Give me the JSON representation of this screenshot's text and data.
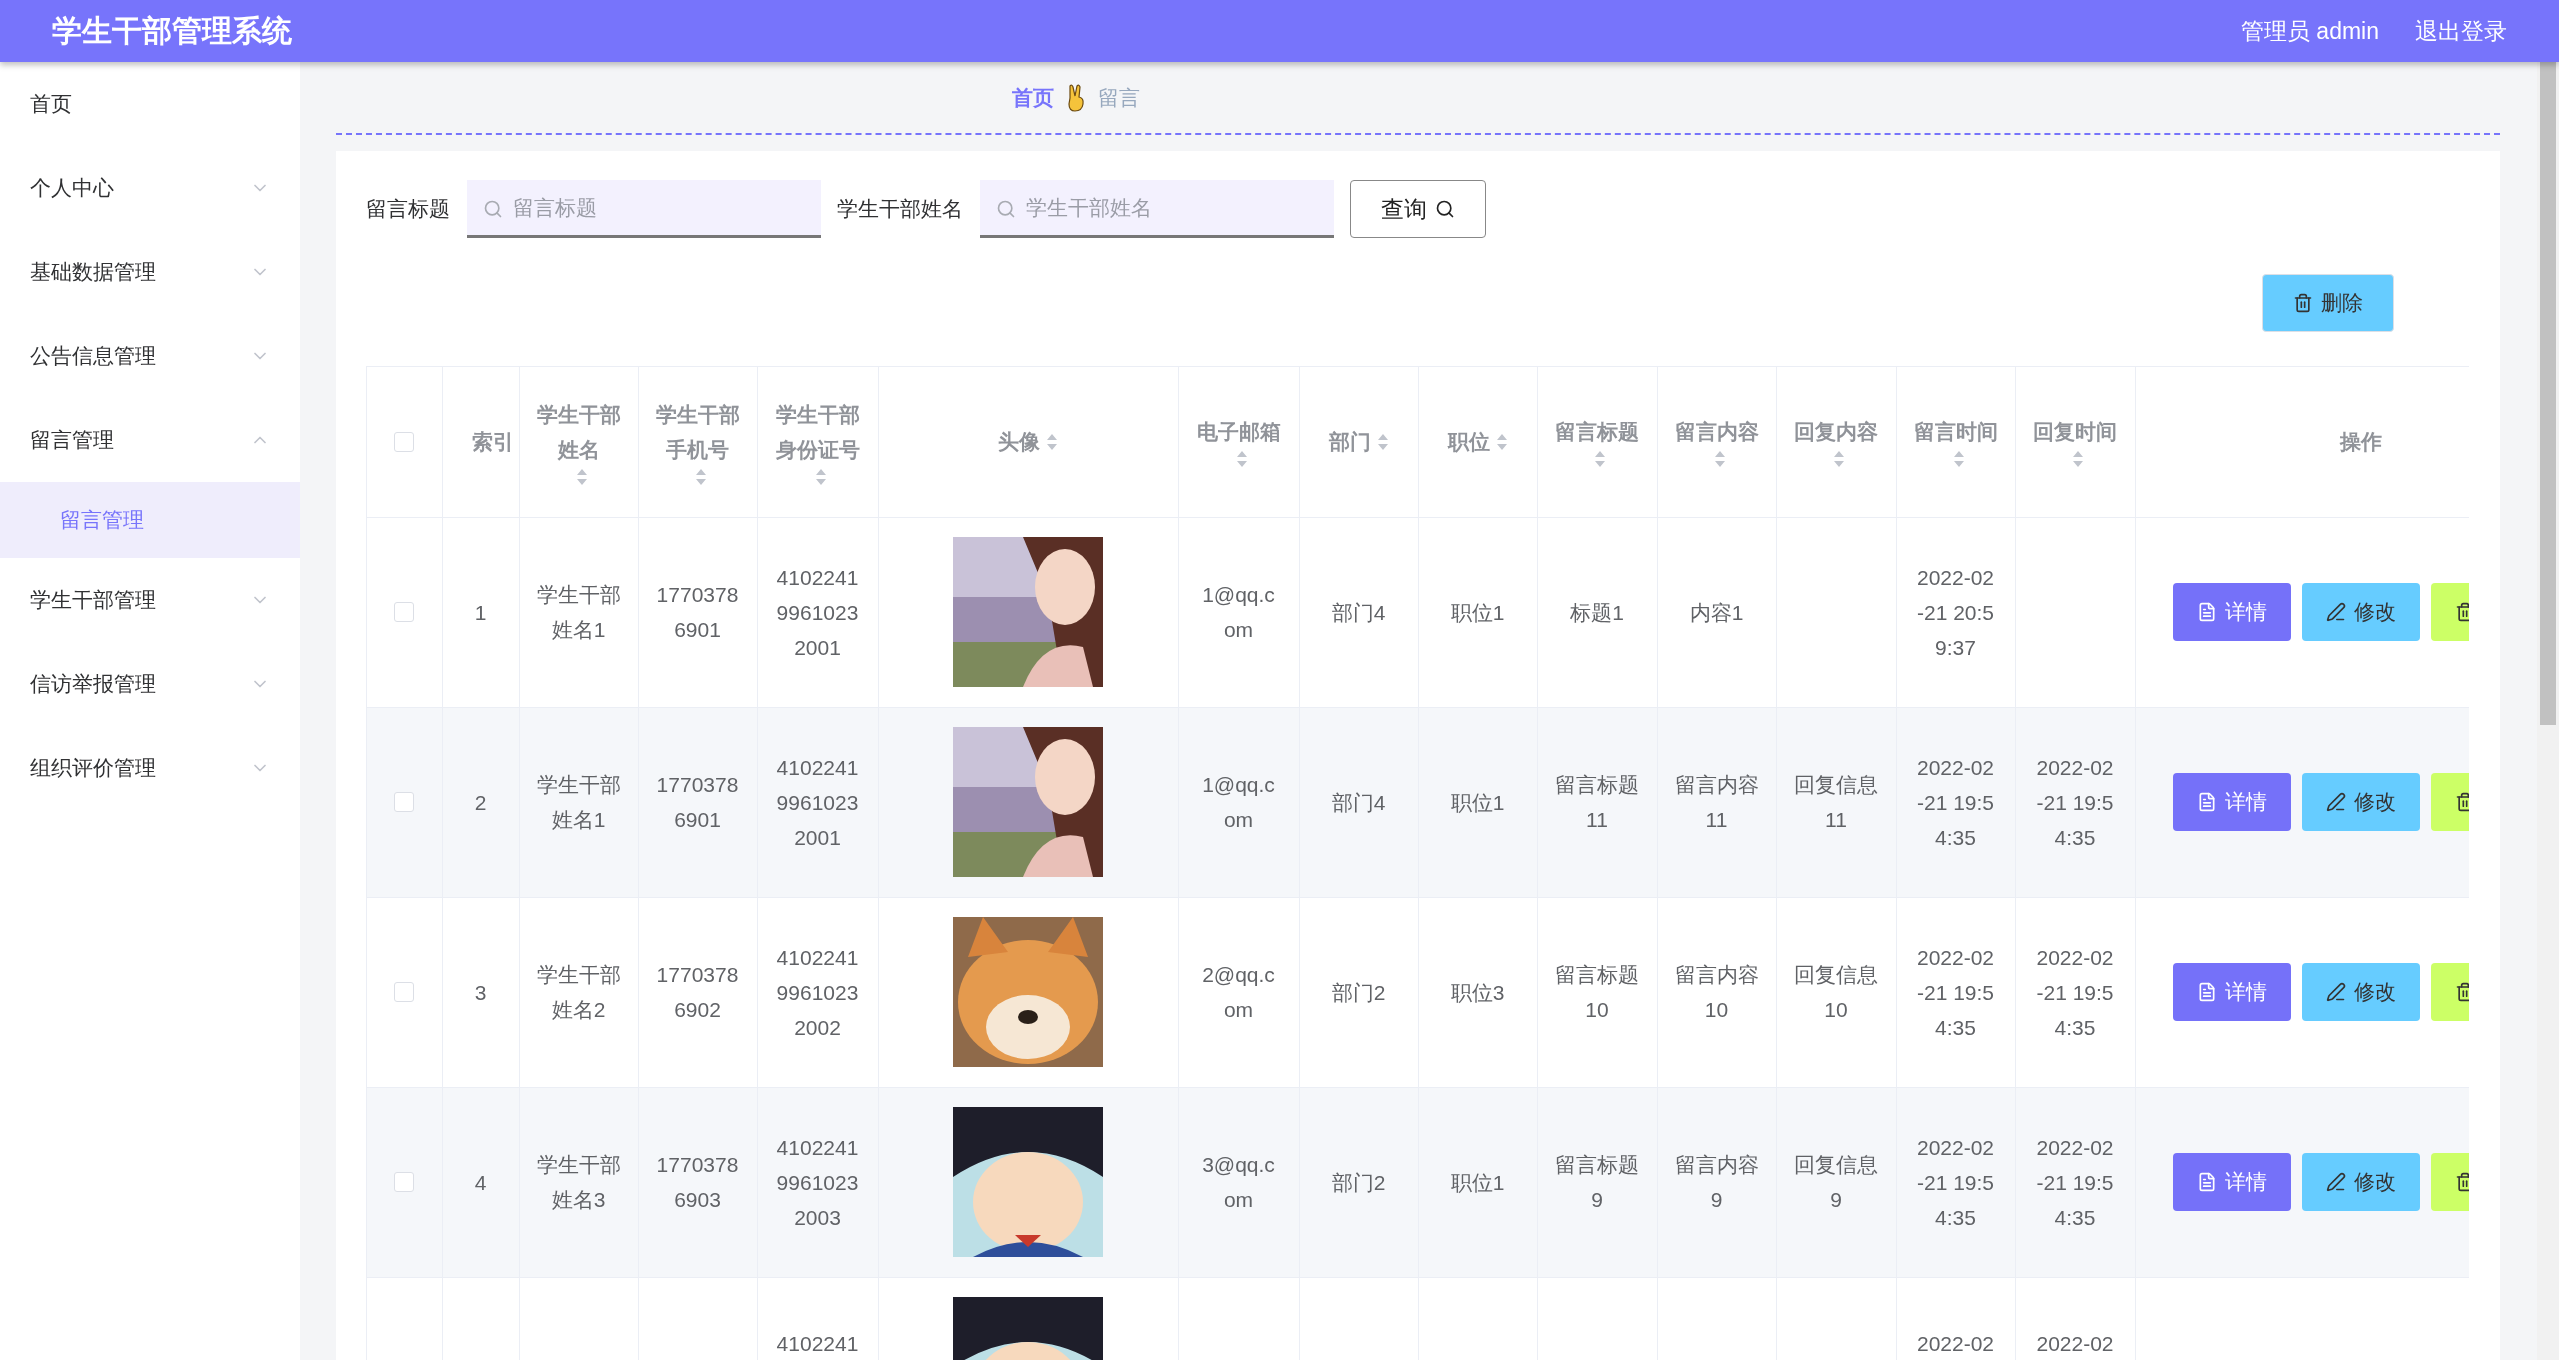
{
  "header": {
    "title": "学生干部管理系统",
    "user": "管理员 admin",
    "logout": "退出登录"
  },
  "sidebar": {
    "items": [
      {
        "label": "首页",
        "kind": "link"
      },
      {
        "label": "个人中心",
        "kind": "menu",
        "expanded": false
      },
      {
        "label": "基础数据管理",
        "kind": "menu",
        "expanded": false
      },
      {
        "label": "公告信息管理",
        "kind": "menu",
        "expanded": false
      },
      {
        "label": "留言管理",
        "kind": "menu",
        "expanded": true,
        "children": [
          {
            "label": "留言管理",
            "selected": true
          }
        ]
      },
      {
        "label": "学生干部管理",
        "kind": "menu",
        "expanded": false
      },
      {
        "label": "信访举报管理",
        "kind": "menu",
        "expanded": false
      },
      {
        "label": "组织评价管理",
        "kind": "menu",
        "expanded": false
      }
    ]
  },
  "breadcrumb": {
    "home": "首页",
    "current": "留言"
  },
  "search": {
    "fields": [
      {
        "label": "留言标题",
        "placeholder": "留言标题"
      },
      {
        "label": "学生干部姓名",
        "placeholder": "学生干部姓名"
      }
    ],
    "button": "查询"
  },
  "toolbar": {
    "delete": "删除"
  },
  "table": {
    "select_all": {
      "checked": false
    },
    "columns": [
      {
        "label": "索引",
        "sortable": false
      },
      {
        "label": "学生干部姓名",
        "sortable": true
      },
      {
        "label": "学生干部手机号",
        "sortable": true
      },
      {
        "label": "学生干部身份证号",
        "sortable": true
      },
      {
        "label": "头像",
        "sortable": true
      },
      {
        "label": "电子邮箱",
        "sortable": true
      },
      {
        "label": "部门",
        "sortable": true
      },
      {
        "label": "职位",
        "sortable": true
      },
      {
        "label": "留言标题",
        "sortable": true
      },
      {
        "label": "留言内容",
        "sortable": true
      },
      {
        "label": "回复内容",
        "sortable": true
      },
      {
        "label": "留言时间",
        "sortable": true
      },
      {
        "label": "回复时间",
        "sortable": true
      },
      {
        "label": "操作",
        "sortable": false
      }
    ],
    "rows": [
      {
        "checked": false,
        "index": "1",
        "name": "学生干部姓名1",
        "phone": "17703786901",
        "id_number": "410224199610232001",
        "email": "1@qq.com",
        "department": "部门4",
        "position": "职位1",
        "title": "标题1",
        "content": "内容1",
        "created": "2022-02-21 20:59:37",
        "actions": [
          {
            "kind": "detail",
            "label": "详情"
          },
          {
            "kind": "edit",
            "label": "修改"
          },
          {
            "kind": "delete"
          }
        ]
      },
      {
        "checked": false,
        "index": "2",
        "name": "学生干部姓名1",
        "phone": "17703786901",
        "id_number": "410224199610232001",
        "email": "1@qq.com",
        "department": "部门4",
        "position": "职位1",
        "title": "留言标题11",
        "content": "留言内容11",
        "reply": "回复信息11",
        "created": "2022-02-21 19:54:35",
        "replied": "2022-02-21 19:54:35",
        "actions": [
          {
            "kind": "detail",
            "label": "详情"
          },
          {
            "kind": "edit",
            "label": "修改"
          },
          {
            "kind": "delete"
          }
        ]
      },
      {
        "checked": false,
        "index": "3",
        "name": "学生干部姓名2",
        "phone": "17703786902",
        "id_number": "410224199610232002",
        "email": "2@qq.com",
        "department": "部门2",
        "position": "职位3",
        "title": "留言标题10",
        "content": "留言内容10",
        "reply": "回复信息10",
        "created": "2022-02-21 19:54:35",
        "replied": "2022-02-21 19:54:35",
        "actions": [
          {
            "kind": "detail",
            "label": "详情"
          },
          {
            "kind": "edit",
            "label": "修改"
          },
          {
            "kind": "delete"
          }
        ]
      },
      {
        "checked": false,
        "index": "4",
        "name": "学生干部姓名3",
        "phone": "17703786903",
        "id_number": "410224199610232003",
        "email": "3@qq.com",
        "department": "部门2",
        "position": "职位1",
        "title": "留言标题9",
        "content": "留言内容9",
        "reply": "回复信息9",
        "created": "2022-02-21 19:54:35",
        "replied": "2022-02-21 19:54:35",
        "actions": [
          {
            "kind": "detail",
            "label": "详情"
          },
          {
            "kind": "edit",
            "label": "修改"
          },
          {
            "kind": "delete"
          }
        ]
      }
    ],
    "cut_row": {
      "id_number": "4102241",
      "created": "2022-02",
      "replied": "2022-02"
    }
  }
}
